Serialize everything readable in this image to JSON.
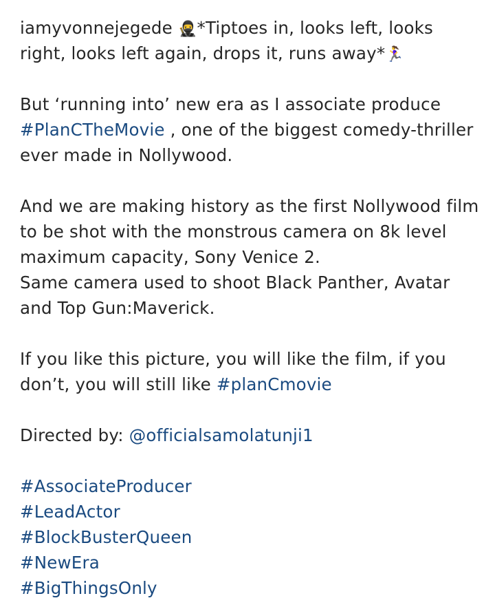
{
  "post": {
    "username": "iamyvonnejegede",
    "emoji_ninja": "🥷",
    "line1_text": "*Tiptoes in, looks left, looks right, looks left again, drops it, runs away*",
    "emoji_runner": "🏃‍♀️",
    "p2_before": "But ‘running into’ new era as I associate produce ",
    "p2_tag": "#PlanCTheMovie",
    "p2_after": " , one of the biggest comedy-thriller ever made in Nollywood.",
    "p3_line1": "And we are making history as the first Nollywood film to be shot with the monstrous camera on 8k level maximum capacity, Sony Venice 2.",
    "p3_line2": "Same camera used to shoot Black Panther, Avatar and Top Gun:Maverick.",
    "p4_before": "If you like this picture, you will like the film, if you don’t, you will still like ",
    "p4_tag": "#planCmovie",
    "p5_label": "Directed by: ",
    "p5_mention": "@officialsamolatunji1",
    "hashtags": [
      "#AssociateProducer",
      "#LeadActor",
      "#BlockBusterQueen",
      "#NewEra",
      "#BigThingsOnly"
    ]
  }
}
